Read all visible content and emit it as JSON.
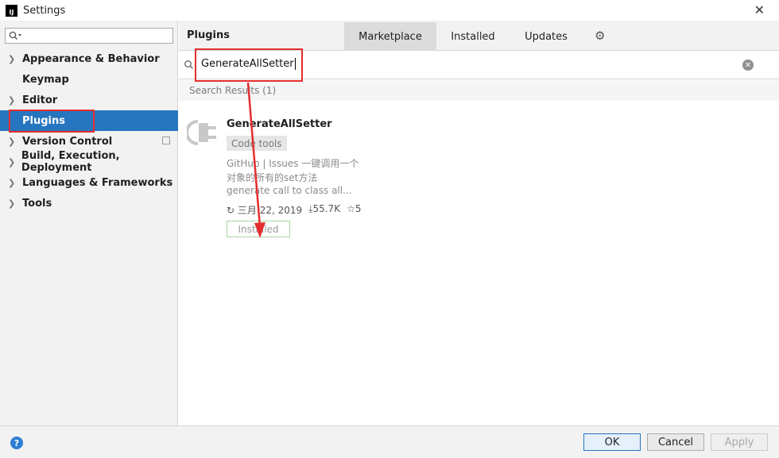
{
  "window": {
    "title": "Settings",
    "app_icon_text": "IJ",
    "close_glyph": "✕"
  },
  "sidebar": {
    "items": [
      {
        "label": "Appearance & Behavior",
        "expandable": true
      },
      {
        "label": "Keymap",
        "expandable": false
      },
      {
        "label": "Editor",
        "expandable": true
      },
      {
        "label": "Plugins",
        "expandable": false,
        "selected": true
      },
      {
        "label": "Version Control",
        "expandable": true
      },
      {
        "label": "Build, Execution, Deployment",
        "expandable": true
      },
      {
        "label": "Languages & Frameworks",
        "expandable": true
      },
      {
        "label": "Tools",
        "expandable": true
      }
    ]
  },
  "header": {
    "title": "Plugins",
    "tabs": [
      {
        "label": "Marketplace",
        "active": true
      },
      {
        "label": "Installed",
        "active": false
      },
      {
        "label": "Updates",
        "active": false
      }
    ],
    "settings_icon": "gear-icon"
  },
  "search": {
    "value": "GenerateAllSetter"
  },
  "results": {
    "header": "Search Results (1)",
    "plugin": {
      "name": "GenerateAllSetter",
      "tag": "Code tools",
      "description_lines": [
        "GitHub | Issues 一键调用一个",
        "对象的所有的set方法",
        "generate call to class all..."
      ],
      "date": "三月 22, 2019",
      "downloads": "55.7K",
      "rating": "5",
      "status_button": "Installed"
    }
  },
  "footer": {
    "help": "?",
    "ok": "OK",
    "cancel": "Cancel",
    "apply": "Apply"
  },
  "colors": {
    "selection": "#2675bf",
    "annotation": "#e52d2d",
    "installed_border": "#a8d5a1"
  }
}
